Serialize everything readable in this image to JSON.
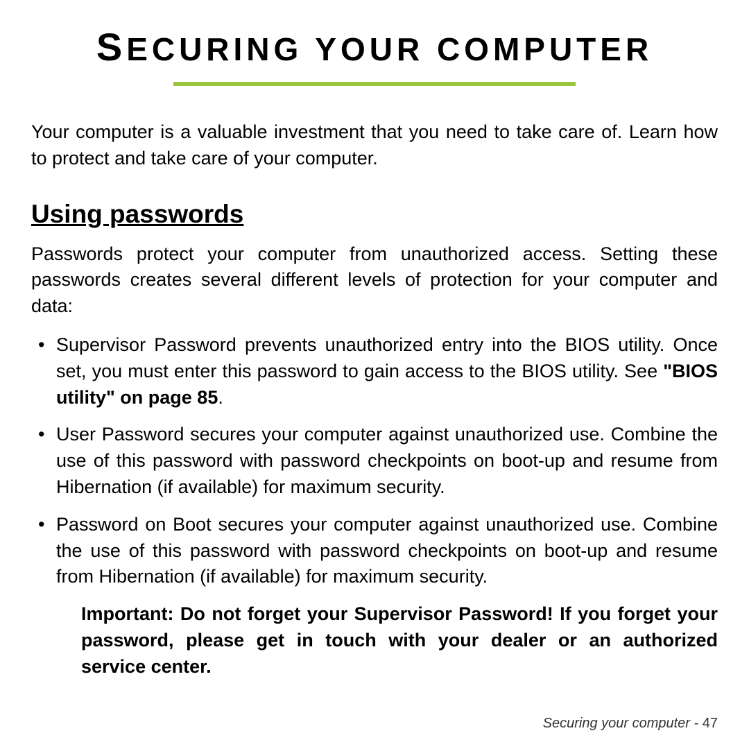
{
  "title_html": "<span class='first-cap'>S</span>ECURING YOUR COMPUTER",
  "intro": "Your computer is a valuable investment that you need to take care of. Learn how to protect and take care of your computer.",
  "section_heading": "Using passwords",
  "section_intro": "Passwords protect your computer from unauthorized access. Setting these passwords creates several different levels of protection for your computer and data:",
  "bullets": [
    {
      "pre": "Supervisor Password prevents unauthorized entry into the BIOS utility. Once set, you must enter this password to gain access to the BIOS utility. See ",
      "bold": "\"BIOS utility\" on page 85",
      "post": "."
    },
    {
      "pre": "User Password secures your computer against unauthorized use. Combine the use of this password with password checkpoints on boot-up and resume from Hibernation (if available) for maximum security.",
      "bold": "",
      "post": ""
    },
    {
      "pre": "Password on Boot secures your computer against unauthorized use. Combine the use of this password with password checkpoints on boot-up and resume from Hibernation (if available) for maximum security.",
      "bold": "",
      "post": ""
    }
  ],
  "important_note": "Important: Do not forget your Supervisor Password! If you forget your password, please get in touch with your dealer or an authorized service center.",
  "footer_text": "Securing your computer -",
  "footer_page": "  47",
  "accent_color": "#9bc53d"
}
